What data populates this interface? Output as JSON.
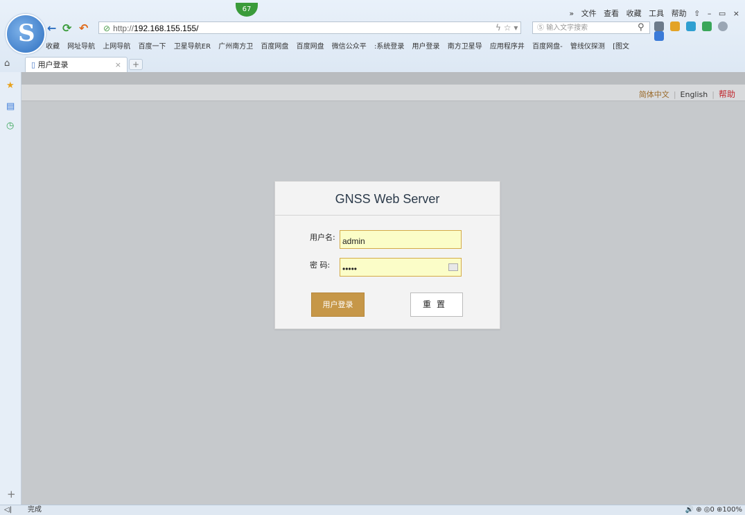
{
  "browser": {
    "badge": "67",
    "menu": [
      "»",
      "文件",
      "查看",
      "收藏",
      "工具",
      "帮助",
      "⇧",
      "–",
      "▭",
      "×"
    ],
    "url_proto": "http://",
    "url_host": "192.168.155.155/",
    "search_placeholder": "输入文字搜索",
    "bookmarks": [
      "收藏",
      "网址导航",
      "上网导航",
      "百度一下",
      "卫星导航ER",
      "广州南方卫",
      "百度网盘",
      "百度网盘",
      "微信公众平",
      ":系统登录",
      "用户登录",
      "南方卫星导",
      "应用程序井",
      "百度网盘-",
      "管线仪探测",
      "[图文"
    ],
    "tab_title": "用户登录"
  },
  "page": {
    "lang_zh": "简体中文",
    "lang_en": "English",
    "help": "帮助",
    "title": "GNSS Web Server",
    "username_label": "用户名:",
    "username_value": "admin",
    "password_label": "密 码:",
    "password_value": "•••••",
    "login_button": "用户登录",
    "reset_button": "重置"
  },
  "status": {
    "text": "完成",
    "right": "🔊  ⊕  ◎0  ⊕100%"
  },
  "colors": {
    "accent_button": "#c69748",
    "field_bg": "#fbfdc8",
    "help_red": "#c0272d"
  }
}
